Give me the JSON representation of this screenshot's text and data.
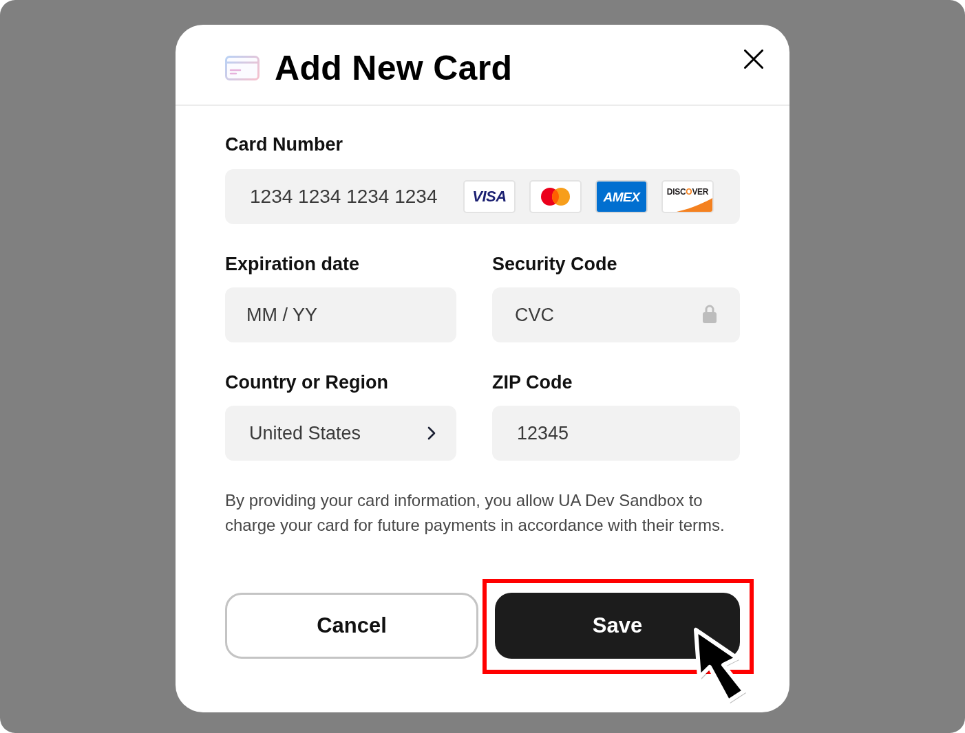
{
  "dialog": {
    "title": "Add New Card"
  },
  "card_number": {
    "label": "Card Number",
    "placeholder": "1234 1234 1234 1234",
    "brands": [
      {
        "kind": "italic",
        "text": "VISA"
      },
      {
        "kind": "circles"
      },
      {
        "kind": "boxed",
        "text": "AMEX"
      },
      {
        "kind": "swoosh",
        "text": "DISCOVER"
      }
    ]
  },
  "expiration": {
    "label": "Expiration date",
    "placeholder": "MM / YY"
  },
  "security_code": {
    "label": "Security Code",
    "placeholder": "CVC"
  },
  "country": {
    "label": "Country or Region",
    "value": "United States"
  },
  "zip": {
    "label": "ZIP Code",
    "placeholder": "12345"
  },
  "notice": "By providing your card information, you allow UA Dev Sandbox to charge your card for future payments in accordance with their terms.",
  "buttons": [
    {
      "kind": "secondary",
      "label": "Cancel"
    },
    {
      "kind": "primary",
      "label": "Save"
    }
  ]
}
